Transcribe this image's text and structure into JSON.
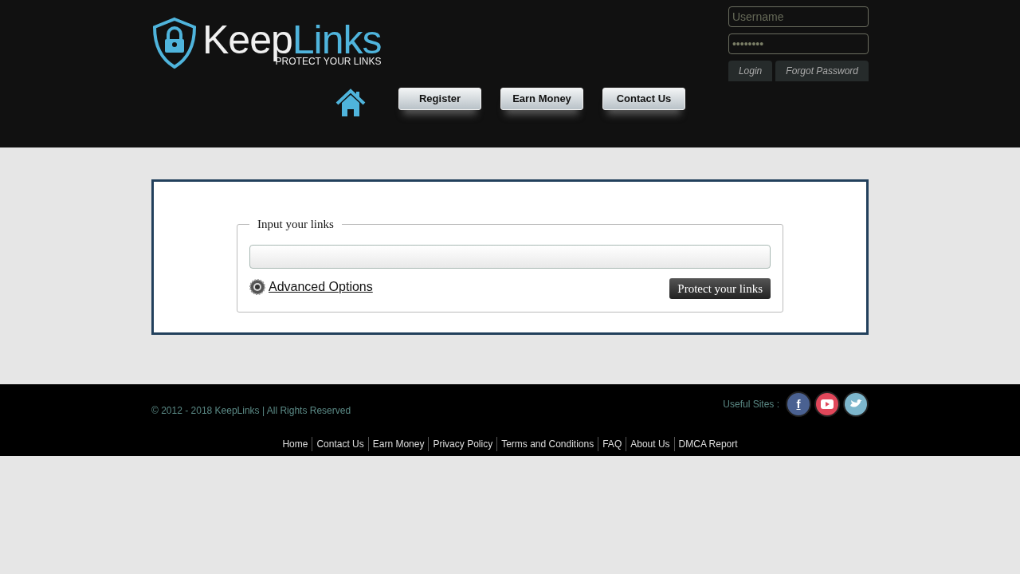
{
  "header": {
    "logo": {
      "word_1": "Keep",
      "word_2": "Links",
      "tagline": "PROTECT YOUR LINKS"
    },
    "login": {
      "username": {
        "placeholder": "Username"
      },
      "password": {
        "value": "••••••••"
      },
      "buttons": [
        "Login",
        "Forgot Password"
      ]
    },
    "nav": [
      {
        "kind": "home"
      },
      {
        "kind": "button",
        "label": "Register"
      },
      {
        "kind": "button",
        "label": "Earn Money"
      },
      {
        "kind": "button",
        "label": "Contact Us"
      }
    ]
  },
  "form": {
    "legend": "Input your links",
    "advanced": "Advanced Options",
    "submit": "Protect your links"
  },
  "footer": {
    "copyright": "© 2012 - 2018 KeepLinks | All Rights Reserved",
    "useful_label": "Useful Sites :",
    "social": [
      {
        "kind": "facebook",
        "label": "f",
        "color": "#4a6191"
      },
      {
        "kind": "youtube",
        "color": "#e0475a"
      },
      {
        "kind": "twitter",
        "color": "#7db6cc"
      }
    ],
    "links": [
      "Home",
      "Contact Us",
      "Earn Money",
      "Privacy Policy",
      "Terms and Conditions",
      "FAQ",
      "About Us",
      "DMCA Report"
    ]
  }
}
